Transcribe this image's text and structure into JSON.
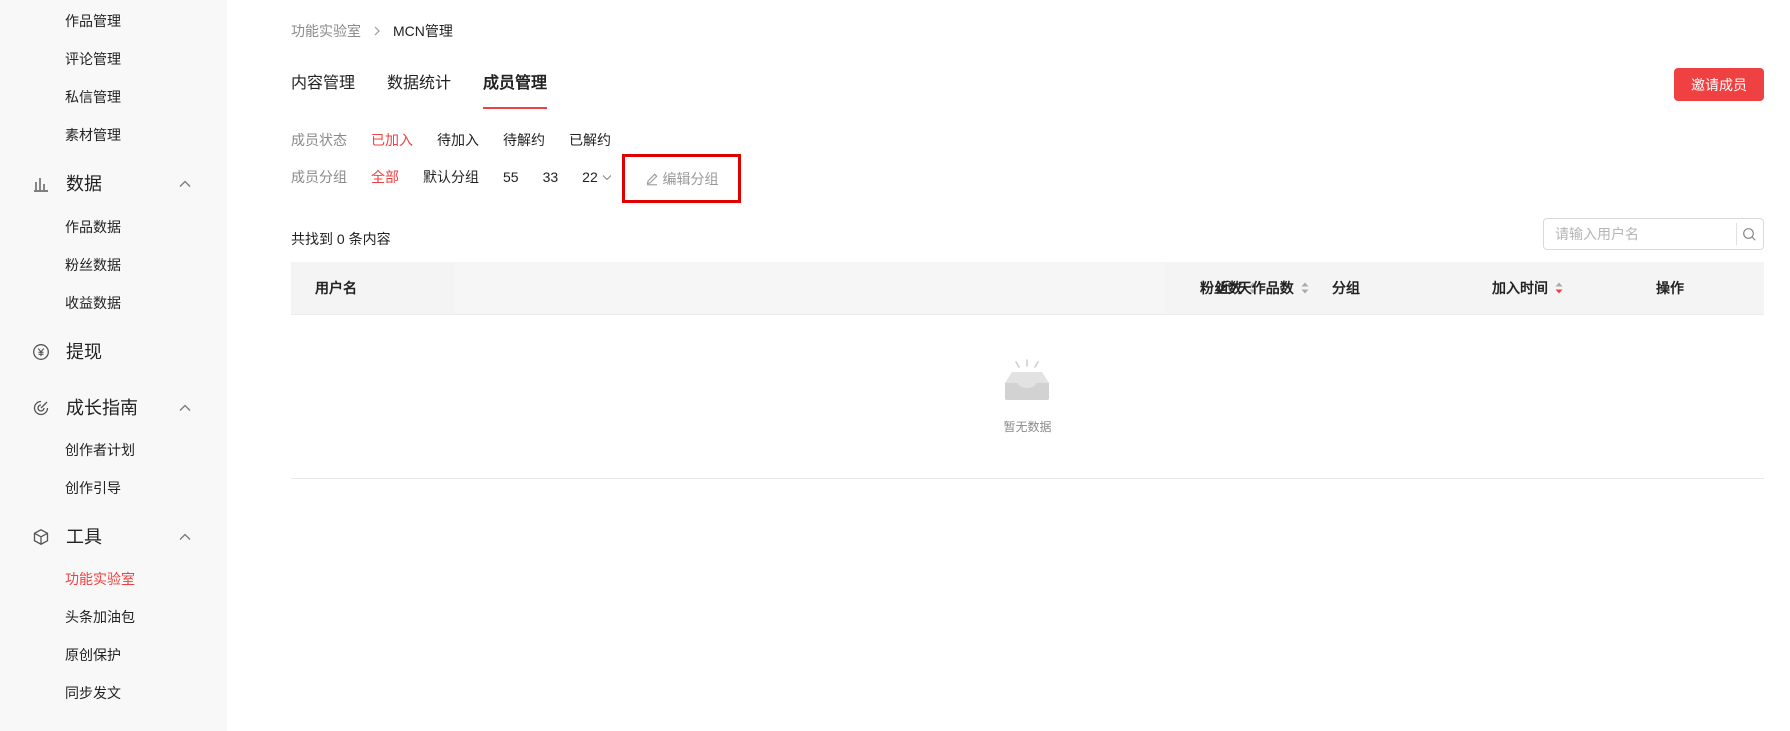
{
  "sidebar": {
    "top_items": [
      "作品管理",
      "评论管理",
      "私信管理",
      "素材管理"
    ],
    "groups": [
      {
        "icon": "bar-chart-icon",
        "label": "数据",
        "items": [
          "作品数据",
          "粉丝数据",
          "收益数据"
        ]
      },
      {
        "icon": "yuan-coin-icon",
        "label": "提现",
        "items": []
      },
      {
        "icon": "growth-compass-icon",
        "label": "成长指南",
        "items": [
          "创作者计划",
          "创作引导"
        ]
      },
      {
        "icon": "toolbox-icon",
        "label": "工具",
        "items": [
          "功能实验室",
          "头条加油包",
          "原创保护",
          "同步发文"
        ]
      }
    ],
    "active_item": "功能实验室"
  },
  "breadcrumb": {
    "parent": "功能实验室",
    "current": "MCN管理"
  },
  "tabs": [
    {
      "label": "内容管理",
      "active": false
    },
    {
      "label": "数据统计",
      "active": false
    },
    {
      "label": "成员管理",
      "active": true
    }
  ],
  "invite_button": "邀请成员",
  "filters": {
    "status": {
      "label": "成员状态",
      "options": [
        "已加入",
        "待加入",
        "待解约",
        "已解约"
      ],
      "selected": "已加入"
    },
    "group": {
      "label": "成员分组",
      "options": [
        "全部",
        "默认分组",
        "55",
        "33"
      ],
      "dropdown_option": "22",
      "selected": "全部"
    },
    "edit_group": "编辑分组"
  },
  "result_count": "共找到 0 条内容",
  "search": {
    "placeholder": "请输入用户名",
    "value": ""
  },
  "table": {
    "columns": {
      "username": "用户名",
      "fans": "粉丝数",
      "works_7d": "近7天作品数",
      "group": "分组",
      "join_time": "加入时间",
      "actions": "操作"
    },
    "rows": [],
    "empty_text": "暂无数据"
  },
  "colors": {
    "accent": "#f04142",
    "highlight_box": "#e00000",
    "sidebar_bg": "#f8f8f8"
  }
}
